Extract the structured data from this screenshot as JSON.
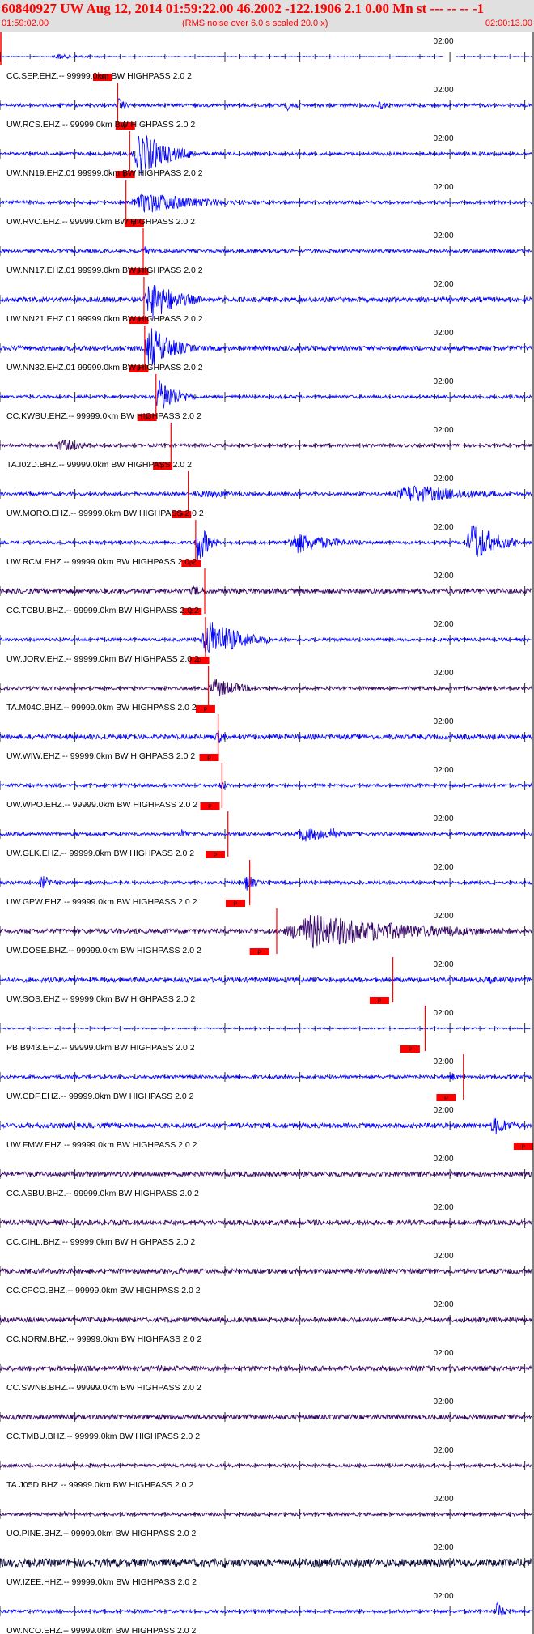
{
  "header": {
    "title": "60840927 UW Aug 12, 2014 01:59:22.00   46.2002 -122.1906  2.1 0.00 Mn st --- -- --  -1",
    "start_time": "01:59:02.00",
    "rms_note": "(RMS noise over 6.0 s scaled 20.0 x)",
    "end_time": "02:00:13.00"
  },
  "chart_data": {
    "type": "line",
    "title": "60840927 UW Aug 12, 2014 01:59:22.00   46.2002 -122.1906  2.1 0.00 Mn st --- -- --  -1",
    "x_start": "01:59:02.00",
    "x_end": "02:00:13.00",
    "xlim_seconds": [
      0,
      71
    ],
    "tick_label": "02:00",
    "tick_label_second": 58,
    "colors": {
      "blue": "#0000ff",
      "purple": "#330066",
      "pick": "#ff0000",
      "header_bg": "#e0e0e0"
    },
    "traces": [
      {
        "name": "CC.SEP.EHZ.--",
        "dist": "99999.0km",
        "filter": "BW  HIGHPASS  2.0  2",
        "color": "#0000ff",
        "pick_s": -1,
        "marker_s": 13.7,
        "pick_label": "Pn",
        "bursts": [
          [
            6,
            18,
            3
          ]
        ],
        "amp": 0.5,
        "gap": [
          59.2,
          60.8
        ]
      },
      {
        "name": "UW.RCS.EHZ.--",
        "dist": "99999.0km",
        "filter": "BW  HIGHPASS  2.0  2",
        "color": "#0000ff",
        "pick_s": 15.7,
        "marker_s": 16.7,
        "pick_label": "P",
        "bursts": [
          [
            15.5,
            17.5,
            10
          ],
          [
            38,
            41,
            8
          ],
          [
            50,
            53,
            6
          ]
        ],
        "amp": 2
      },
      {
        "name": "UW.NN19.EHZ.01",
        "dist": "99999.0km",
        "filter": "BW  HIGHPASS  2.0  2",
        "color": "#0000ff",
        "pick_s": 17.3,
        "marker_s": 16.7,
        "pick_label": "P",
        "bursts": [
          [
            17.5,
            26,
            28
          ]
        ],
        "amp": 2
      },
      {
        "name": "UW.RVC.EHZ.--",
        "dist": "99999.0km",
        "filter": "BW  HIGHPASS  2.0  2",
        "color": "#0000ff",
        "pick_s": 16.8,
        "marker_s": 17.9,
        "pick_label": "P",
        "bursts": [
          [
            17,
            34,
            14
          ]
        ],
        "amp": 2
      },
      {
        "name": "UW.NN17.EHZ.01",
        "dist": "99999.0km",
        "filter": "BW  HIGHPASS  2.0  2",
        "color": "#0000ff",
        "pick_s": 19.1,
        "marker_s": 18.5,
        "pick_label": "P",
        "bursts": [
          [
            18.8,
            22,
            6
          ]
        ],
        "amp": 2
      },
      {
        "name": "UW.NN21.EHZ.01",
        "dist": "99999.0km",
        "filter": "BW  HIGHPASS  2.0  2",
        "color": "#0000ff",
        "pick_s": 19.2,
        "marker_s": 18.5,
        "pick_label": "P",
        "bursts": [
          [
            19,
            27,
            26
          ]
        ],
        "amp": 3
      },
      {
        "name": "UW.NN32.EHZ.01",
        "dist": "99999.0km",
        "filter": "BW  HIGHPASS  2.0  2",
        "color": "#0000ff",
        "pick_s": 19.3,
        "marker_s": 18.5,
        "pick_label": "P",
        "bursts": [
          [
            19,
            26,
            28
          ]
        ],
        "amp": 3
      },
      {
        "name": "CC.KWBU.EHZ.--",
        "dist": "99999.0km",
        "filter": "BW  HIGHPASS  2.0  2",
        "color": "#0000ff",
        "pick_s": 20.8,
        "marker_s": 19.6,
        "pick_label": "P",
        "bursts": [
          [
            20.5,
            26,
            24
          ]
        ],
        "amp": 2
      },
      {
        "name": "TA.I02D.BHZ.--",
        "dist": "99999.0km",
        "filter": "BW  HIGHPASS  2.0  2",
        "color": "#330066",
        "pick_s": 22.8,
        "marker_s": 21.7,
        "pick_label": "P",
        "bursts": [
          [
            7,
            15,
            8
          ]
        ],
        "amp": 2
      },
      {
        "name": "UW.MORO.EHZ.--",
        "dist": "99999.0km",
        "filter": "BW  HIGHPASS  2.0  2",
        "color": "#0000ff",
        "pick_s": 25.1,
        "marker_s": 24.2,
        "pick_label": "P",
        "bursts": [
          [
            25,
            40,
            5
          ],
          [
            52,
            71,
            12
          ]
        ],
        "amp": 2
      },
      {
        "name": "UW.RCM.EHZ.--",
        "dist": "99999.0km",
        "filter": "BW  HIGHPASS  2.0  2",
        "color": "#0000ff",
        "pick_s": 26.1,
        "marker_s": 25.5,
        "pick_label": "P",
        "bursts": [
          [
            26,
            29,
            28
          ],
          [
            38,
            49,
            14
          ],
          [
            62,
            69,
            28
          ]
        ],
        "amp": 2
      },
      {
        "name": "CC.TCBU.BHZ.--",
        "dist": "99999.0km",
        "filter": "BW  HIGHPASS  2.0  2",
        "color": "#330066",
        "pick_s": 27.3,
        "marker_s": 25.6,
        "pick_label": "P",
        "bursts": [
          [
            25,
            31,
            7
          ]
        ],
        "amp": 3
      },
      {
        "name": "UW.JORV.EHZ.--",
        "dist": "99999.0km",
        "filter": "BW  HIGHPASS  2.0  2",
        "color": "#0000ff",
        "pick_s": 27.4,
        "marker_s": 26.6,
        "pick_label": "P",
        "bursts": [
          [
            26.5,
            36,
            26
          ]
        ],
        "amp": 2
      },
      {
        "name": "TA.M04C.BHZ.--",
        "dist": "99999.0km",
        "filter": "BW  HIGHPASS  2.0  2",
        "color": "#330066",
        "pick_s": 27.8,
        "marker_s": 27.4,
        "pick_label": "P",
        "bursts": [
          [
            27.5,
            36,
            12
          ]
        ],
        "amp": 2
      },
      {
        "name": "UW.WIW.EHZ.--",
        "dist": "99999.0km",
        "filter": "BW  HIGHPASS  2.0  2",
        "color": "#0000ff",
        "pick_s": 29.1,
        "marker_s": 27.9,
        "pick_label": "P",
        "bursts": [
          [
            28.5,
            31,
            10
          ]
        ],
        "amp": 3
      },
      {
        "name": "UW.WPO.EHZ.--",
        "dist": "99999.0km",
        "filter": "BW  HIGHPASS  2.0  2",
        "color": "#0000ff",
        "pick_s": 29.6,
        "marker_s": 28.0,
        "pick_label": "P",
        "bursts": [
          [
            29,
            32,
            5
          ]
        ],
        "amp": 2
      },
      {
        "name": "UW.GLK.EHZ.--",
        "dist": "99999.0km",
        "filter": "BW  HIGHPASS  2.0  2",
        "color": "#0000ff",
        "pick_s": 30.4,
        "marker_s": 28.7,
        "pick_label": "P",
        "bursts": [
          [
            24,
            26,
            8
          ],
          [
            39,
            49,
            10
          ],
          [
            44,
            45,
            22
          ]
        ],
        "amp": 2
      },
      {
        "name": "UW.GPW.EHZ.--",
        "dist": "99999.0km",
        "filter": "BW  HIGHPASS  2.0  2",
        "color": "#0000ff",
        "pick_s": 33.3,
        "marker_s": 31.4,
        "pick_label": "P",
        "bursts": [
          [
            5,
            9,
            9
          ],
          [
            32.5,
            35,
            12
          ]
        ],
        "amp": 2
      },
      {
        "name": "UW.DOSE.BHZ.--",
        "dist": "99999.0km",
        "filter": "BW  HIGHPASS  2.0  2",
        "color": "#330066",
        "pick_s": 36.9,
        "marker_s": 34.6,
        "pick_label": "P",
        "bursts": [
          [
            37,
            68,
            22
          ]
        ],
        "amp": 3
      },
      {
        "name": "UW.SOS.EHZ.--",
        "dist": "99999.0km",
        "filter": "BW  HIGHPASS  2.0  2",
        "color": "#0000ff",
        "pick_s": 52.4,
        "marker_s": 50.6,
        "pick_label": "P",
        "bursts": [
          [
            64,
            71,
            5
          ]
        ],
        "amp": 3
      },
      {
        "name": "PB.B943.EHZ.--",
        "dist": "99999.0km",
        "filter": "BW  HIGHPASS  2.0  2",
        "color": "#0000ff",
        "pick_s": 56.7,
        "marker_s": 54.7,
        "pick_label": "P",
        "bursts": [],
        "amp": 1
      },
      {
        "name": "UW.CDF.EHZ.--",
        "dist": "99999.0km",
        "filter": "BW  HIGHPASS  2.0  2",
        "color": "#0000ff",
        "pick_s": 61.8,
        "marker_s": 59.5,
        "pick_label": "P",
        "bursts": [
          [
            60,
            62,
            6
          ]
        ],
        "amp": 2
      },
      {
        "name": "UW.FMW.EHZ.--",
        "dist": "99999.0km",
        "filter": "BW  HIGHPASS  2.0  2",
        "color": "#0000ff",
        "pick_s": -1,
        "marker_s": 69.8,
        "pick_label": "P",
        "bursts": [
          [
            65,
            71,
            12
          ]
        ],
        "amp": 3
      },
      {
        "name": "CC.ASBU.BHZ.--",
        "dist": "99999.0km",
        "filter": "BW  HIGHPASS  2.0  2",
        "color": "#330066",
        "pick_s": -1,
        "marker_s": -1,
        "pick_label": "",
        "bursts": [],
        "amp": 3
      },
      {
        "name": "CC.CIHL.BHZ.--",
        "dist": "99999.0km",
        "filter": "BW  HIGHPASS  2.0  2",
        "color": "#330066",
        "pick_s": -1,
        "marker_s": -1,
        "pick_label": "",
        "bursts": [],
        "amp": 3
      },
      {
        "name": "CC.CPCO.BHZ.--",
        "dist": "99999.0km",
        "filter": "BW  HIGHPASS  2.0  2",
        "color": "#330066",
        "pick_s": -1,
        "marker_s": -1,
        "pick_label": "",
        "bursts": [
          [
            22,
            30,
            5
          ]
        ],
        "amp": 3
      },
      {
        "name": "CC.NORM.BHZ.--",
        "dist": "99999.0km",
        "filter": "BW  HIGHPASS  2.0  2",
        "color": "#330066",
        "pick_s": -1,
        "marker_s": -1,
        "pick_label": "",
        "bursts": [
          [
            20,
            34,
            4
          ]
        ],
        "amp": 3
      },
      {
        "name": "CC.SWNB.BHZ.--",
        "dist": "99999.0km",
        "filter": "BW  HIGHPASS  2.0  2",
        "color": "#330066",
        "pick_s": -1,
        "marker_s": -1,
        "pick_label": "",
        "bursts": [
          [
            20,
            28,
            5
          ]
        ],
        "amp": 3
      },
      {
        "name": "CC.TMBU.BHZ.--",
        "dist": "99999.0km",
        "filter": "BW  HIGHPASS  2.0  2",
        "color": "#330066",
        "pick_s": -1,
        "marker_s": -1,
        "pick_label": "",
        "bursts": [],
        "amp": 3
      },
      {
        "name": "TA.J05D.BHZ.--",
        "dist": "99999.0km",
        "filter": "BW  HIGHPASS  2.0  2",
        "color": "#330066",
        "pick_s": -1,
        "marker_s": -1,
        "pick_label": "",
        "bursts": [],
        "amp": 2
      },
      {
        "name": "UO.PINE.BHZ.--",
        "dist": "99999.0km",
        "filter": "BW  HIGHPASS  2.0  2",
        "color": "#330066",
        "pick_s": -1,
        "marker_s": -1,
        "pick_label": "",
        "bursts": [
          [
            8,
            12,
            4
          ]
        ],
        "amp": 2
      },
      {
        "name": "UW.IZEE.HHZ.--",
        "dist": "99999.0km",
        "filter": "BW  HIGHPASS  2.0  2",
        "color": "#000033",
        "pick_s": -1,
        "marker_s": -1,
        "pick_label": "",
        "bursts": [
          [
            58,
            71,
            5
          ]
        ],
        "amp": 5
      },
      {
        "name": "UW.NCO.EHZ.--",
        "dist": "99999.0km",
        "filter": "BW  HIGHPASS  2.0  2",
        "color": "#0000ff",
        "pick_s": -1,
        "marker_s": -1,
        "pick_label": "",
        "bursts": [
          [
            66,
            68,
            14
          ]
        ],
        "amp": 2
      }
    ]
  }
}
